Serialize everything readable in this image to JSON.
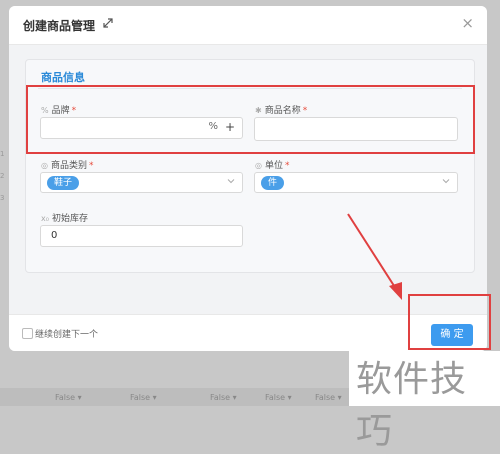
{
  "modal": {
    "title": "创建商品管理",
    "close_symbol": "×"
  },
  "section": {
    "title": "商品信息"
  },
  "fields": {
    "brand": {
      "icon": "%",
      "label": "品牌",
      "required": "*",
      "value": ""
    },
    "product_name": {
      "icon": "✱",
      "label": "商品名称",
      "required": "*",
      "value": ""
    },
    "category": {
      "icon": "◎",
      "label": "商品类别",
      "required": "*",
      "selected": "鞋子"
    },
    "unit": {
      "icon": "◎",
      "label": "单位",
      "required": "*",
      "selected": "件"
    },
    "initial_stock": {
      "icon": "x₀",
      "label": "初始库存",
      "value": "0"
    }
  },
  "footer": {
    "continue_label": "继续创建下一个",
    "confirm_label": "确 定"
  },
  "background": {
    "bottom_tags": [
      "False ▾",
      "False ▾",
      "False ▾",
      "False ▾",
      "False ▾"
    ],
    "side_marks": [
      "1",
      "2",
      "3"
    ]
  },
  "watermark": "软件技巧",
  "colors": {
    "accent": "#3d9bef",
    "section_title": "#2b8ad8",
    "highlight": "#e04040",
    "required": "#e74c3c"
  }
}
